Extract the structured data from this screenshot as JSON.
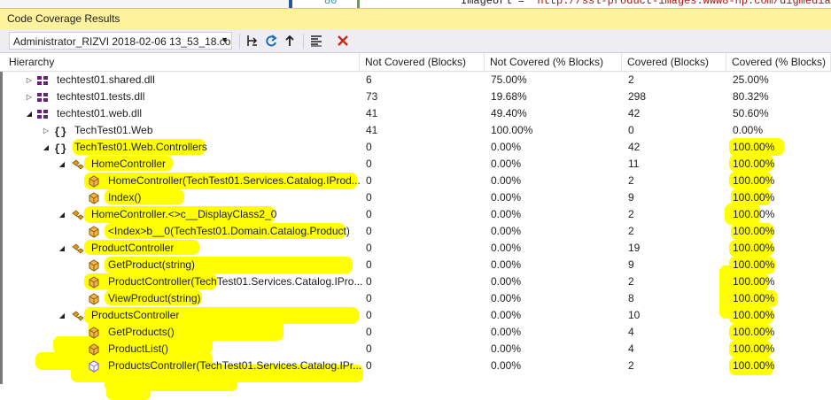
{
  "editor": {
    "line_number": "80",
    "code_prefix": "ImageUrl = ",
    "code_string": "\"http://ssl-product-images.www8-hp.com/digmedialib/prod"
  },
  "panel": {
    "title": "Code Coverage Results"
  },
  "toolbar": {
    "selected_run": "Administrator_RIZVI 2018-02-06 13_53_18.co",
    "buttons": [
      "export-results-icon",
      "import-results-icon",
      "merge-results-icon",
      "add-remove-columns-icon",
      "remove-results-icon"
    ]
  },
  "columns": {
    "hierarchy": "Hierarchy",
    "not_covered_blocks": "Not Covered (Blocks)",
    "not_covered_pct": "Not Covered (% Blocks)",
    "covered_blocks": "Covered (Blocks)",
    "covered_pct": "Covered (% Blocks)"
  },
  "rows": [
    {
      "name": "techtest01.shared.dll",
      "kind": "assembly",
      "expander": "collapsed",
      "level": 0,
      "ncb": "6",
      "ncp": "75.00%",
      "cb": "2",
      "cp": "25.00%"
    },
    {
      "name": "techtest01.tests.dll",
      "kind": "assembly",
      "expander": "collapsed",
      "level": 0,
      "ncb": "73",
      "ncp": "19.68%",
      "cb": "298",
      "cp": "80.32%"
    },
    {
      "name": "techtest01.web.dll",
      "kind": "assembly",
      "expander": "expanded",
      "level": 0,
      "ncb": "41",
      "ncp": "49.40%",
      "cb": "42",
      "cp": "50.60%"
    },
    {
      "name": "TechTest01.Web",
      "kind": "namespace",
      "expander": "collapsed",
      "level": 1,
      "ncb": "41",
      "ncp": "100.00%",
      "cb": "0",
      "cp": "0.00%"
    },
    {
      "name": "TechTest01.Web.Controllers",
      "kind": "namespace",
      "expander": "expanded",
      "level": 1,
      "ncb": "0",
      "ncp": "0.00%",
      "cb": "42",
      "cp": "100.00%"
    },
    {
      "name": "HomeController",
      "kind": "class",
      "expander": "expanded",
      "level": 2,
      "ncb": "0",
      "ncp": "0.00%",
      "cb": "11",
      "cp": "100.00%"
    },
    {
      "name": "HomeController(TechTest01.Services.Catalog.IProd...",
      "kind": "method",
      "expander": "none",
      "level": 3,
      "ncb": "0",
      "ncp": "0.00%",
      "cb": "2",
      "cp": "100.00%"
    },
    {
      "name": "Index()",
      "kind": "method",
      "expander": "none",
      "level": 3,
      "ncb": "0",
      "ncp": "0.00%",
      "cb": "9",
      "cp": "100.00%"
    },
    {
      "name": "HomeController.<>c__DisplayClass2_0",
      "kind": "class",
      "expander": "expanded",
      "level": 2,
      "ncb": "0",
      "ncp": "0.00%",
      "cb": "2",
      "cp": "100.00%"
    },
    {
      "name": "<Index>b__0(TechTest01.Domain.Catalog.Product)",
      "kind": "method",
      "expander": "none",
      "level": 3,
      "ncb": "0",
      "ncp": "0.00%",
      "cb": "2",
      "cp": "100.00%"
    },
    {
      "name": "ProductController",
      "kind": "class",
      "expander": "expanded",
      "level": 2,
      "ncb": "0",
      "ncp": "0.00%",
      "cb": "19",
      "cp": "100.00%"
    },
    {
      "name": "GetProduct(string)",
      "kind": "method",
      "expander": "none",
      "level": 3,
      "ncb": "0",
      "ncp": "0.00%",
      "cb": "9",
      "cp": "100.00%"
    },
    {
      "name": "ProductController(TechTest01.Services.Catalog.IPro...",
      "kind": "method",
      "expander": "none",
      "level": 3,
      "ncb": "0",
      "ncp": "0.00%",
      "cb": "2",
      "cp": "100.00%"
    },
    {
      "name": "ViewProduct(string)",
      "kind": "method",
      "expander": "none",
      "level": 3,
      "ncb": "0",
      "ncp": "0.00%",
      "cb": "8",
      "cp": "100.00%"
    },
    {
      "name": "ProductsController",
      "kind": "class",
      "expander": "expanded",
      "level": 2,
      "ncb": "0",
      "ncp": "0.00%",
      "cb": "10",
      "cp": "100.00%"
    },
    {
      "name": "GetProducts()",
      "kind": "method",
      "expander": "none",
      "level": 3,
      "ncb": "0",
      "ncp": "0.00%",
      "cb": "4",
      "cp": "100.00%"
    },
    {
      "name": "ProductList()",
      "kind": "method",
      "expander": "none",
      "level": 3,
      "ncb": "0",
      "ncp": "0.00%",
      "cb": "4",
      "cp": "100.00%"
    },
    {
      "name": "ProductsController(TechTest01.Services.Catalog.IPr...",
      "kind": "method-purple",
      "expander": "none",
      "level": 3,
      "ncb": "0",
      "ncp": "0.00%",
      "cb": "2",
      "cp": "100.00%"
    }
  ],
  "colors": {
    "title_bar": "#fff29d",
    "highlighter": "#ffff00",
    "assembly_icon": "#68217a",
    "class_icon": "#d69c1e",
    "method_icon": "#c27d0e",
    "method_icon_alt": "#8b6bd1",
    "remove_icon": "#c42b1c"
  }
}
